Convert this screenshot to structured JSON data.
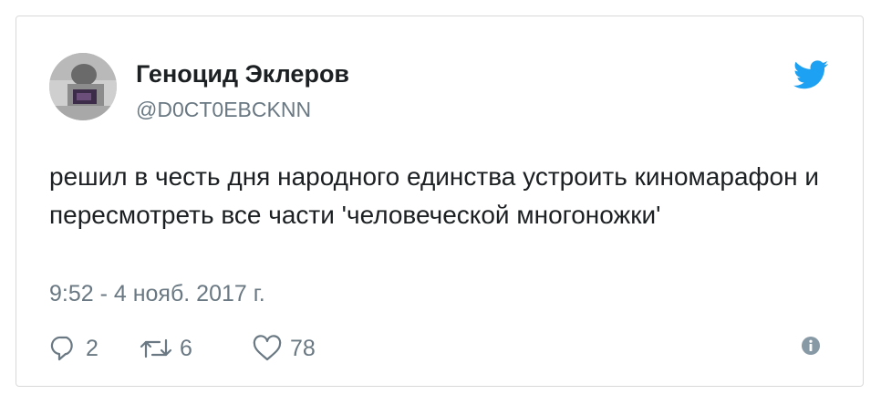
{
  "tweet": {
    "author_name": "Геноцид Эклеров",
    "author_handle": "@D0CT0EBCKNN",
    "text": "решил в честь дня народного единства устроить киномарафон и пересмотреть все части 'человеческой многоножки'",
    "timestamp": "9:52 - 4 нояб. 2017 г.",
    "replies": "2",
    "retweets": "6",
    "likes": "78"
  },
  "icons": {
    "brand": "twitter-bird-icon",
    "reply": "reply-icon",
    "retweet": "retweet-icon",
    "like": "heart-icon",
    "info": "info-icon"
  },
  "colors": {
    "brand": "#1da1f2",
    "text": "#1c2022",
    "muted": "#697882",
    "border": "#d9d9d9"
  }
}
